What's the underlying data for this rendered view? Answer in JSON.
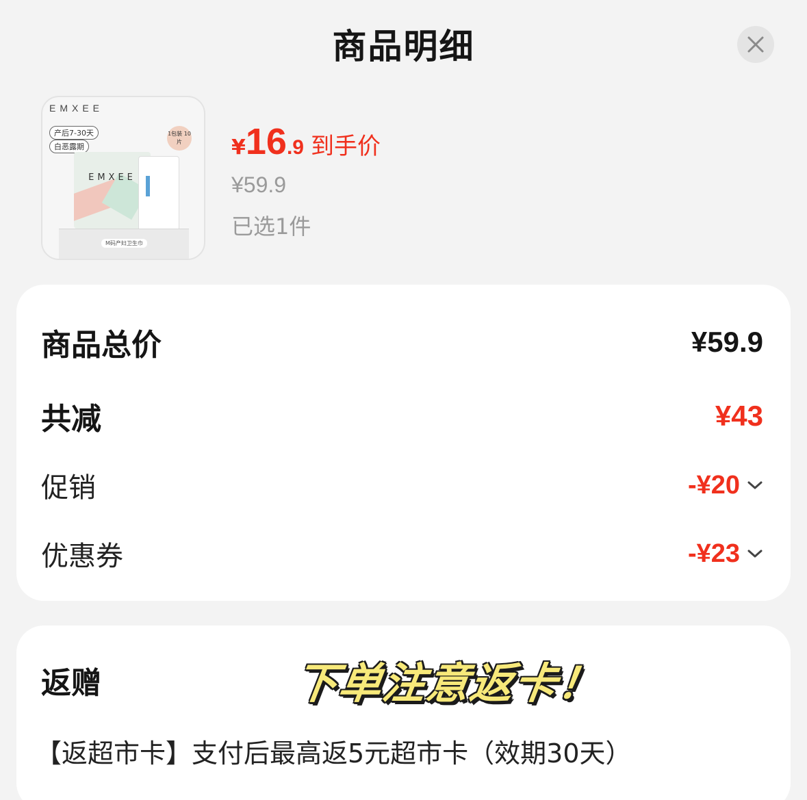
{
  "header": {
    "title": "商品明细",
    "close_icon": "close-icon"
  },
  "product": {
    "thumbnail": {
      "brand": "EMXEE",
      "tag1": "产后7-30天",
      "tag2": "白恶露期",
      "badge": "1包装 10片",
      "pack_brand": "EMXEE",
      "base_label": "M码产妇卫生巾"
    },
    "price_currency": "¥",
    "price_int": "16",
    "price_dec": ".9",
    "price_label": "到手价",
    "original_price": "¥59.9",
    "selected_text": "已选1件"
  },
  "summary": {
    "total_label": "商品总价",
    "total_value": "¥59.9",
    "reduce_label": "共减",
    "reduce_value": "¥43",
    "promo_label": "促销",
    "promo_value": "-¥20",
    "coupon_label": "优惠券",
    "coupon_value": "-¥23"
  },
  "returns": {
    "label": "返赠",
    "banner": "下单注意返卡！",
    "description": "【返超市卡】支付后最高返5元超市卡（效期30天）"
  },
  "colors": {
    "accent_red": "#f0301d",
    "background": "#f3f3f3",
    "card": "#ffffff"
  }
}
